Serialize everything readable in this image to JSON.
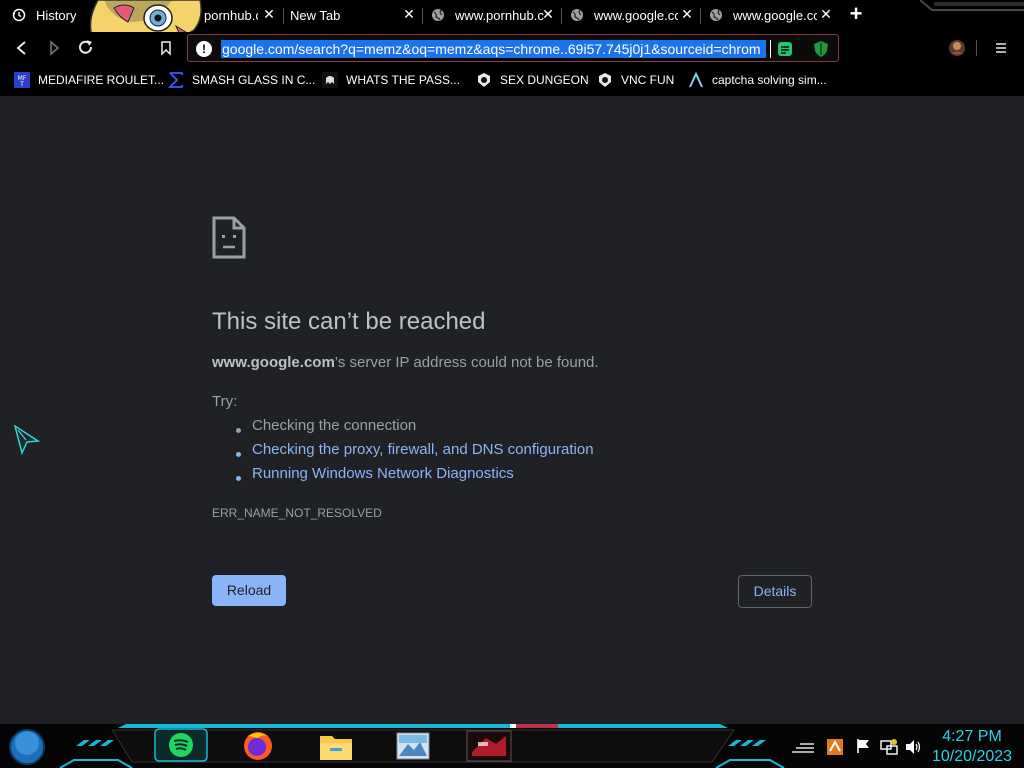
{
  "tabs": [
    {
      "label": "History",
      "icon": "history-icon"
    },
    {
      "label": "pornhub.c",
      "icon": "none"
    },
    {
      "label": "New Tab",
      "icon": "none"
    },
    {
      "label": "www.pornhub.c",
      "icon": "globe-icon"
    },
    {
      "label": "www.google.co",
      "icon": "globe-icon"
    },
    {
      "label": "www.google.co",
      "icon": "globe-icon"
    }
  ],
  "omnibox": {
    "url": "google.com/search?q=memz&oq=memz&aqs=chrome..69i57.745j0j1&sourceid=chrom"
  },
  "bookmarks": [
    {
      "label": "MEDIAFIRE ROULET...",
      "icon": "mediafire-icon"
    },
    {
      "label": "SMASH GLASS IN C...",
      "icon": "sigma-icon"
    },
    {
      "label": "WHATS THE PASS...",
      "icon": "ghost-icon"
    },
    {
      "label": "SEX DUNGEON",
      "icon": "badge-icon"
    },
    {
      "label": "VNC FUN",
      "icon": "badge-icon"
    },
    {
      "label": "captcha solving sim...",
      "icon": "lambda-icon"
    }
  ],
  "error": {
    "title": "This site can’t be reached",
    "host": "www.google.com",
    "desc_rest": "’s server IP address could not be found.",
    "try_label": "Try:",
    "suggestions": [
      {
        "text": "Checking the connection",
        "is_link": false
      },
      {
        "text": "Checking the proxy, firewall, and DNS configuration",
        "is_link": true
      },
      {
        "text": "Running Windows Network Diagnostics",
        "is_link": true
      }
    ],
    "code": "ERR_NAME_NOT_RESOLVED",
    "reload_label": "Reload",
    "details_label": "Details"
  },
  "taskbar": {
    "time": "4:27 PM",
    "date": "10/20/2023",
    "apps": [
      "spotify-icon",
      "firefox-icon",
      "file-explorer-icon",
      "photos-icon",
      "game-icon"
    ]
  },
  "colors": {
    "page_bg": "#202124",
    "link": "#8ab4f8",
    "text": "#9aa0a6",
    "url_highlight": "#1a73e8",
    "clock": "#29d4e8",
    "taskbar_accent": "#19b8d4"
  }
}
